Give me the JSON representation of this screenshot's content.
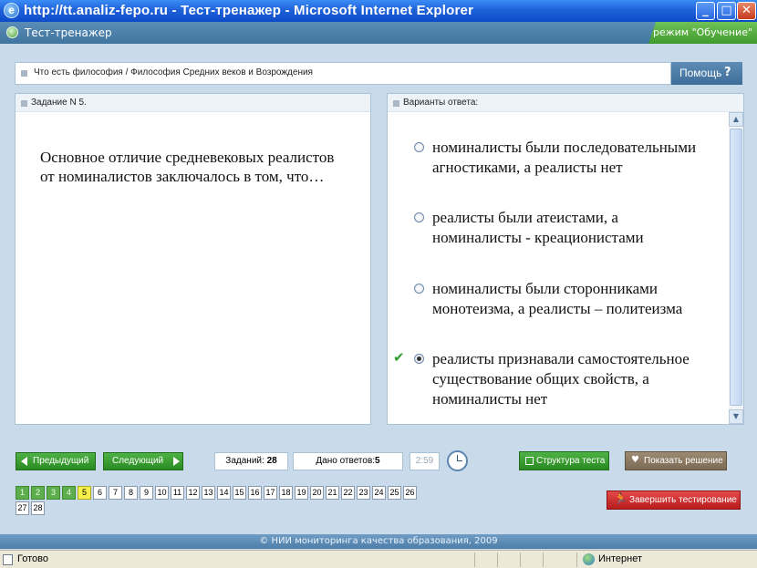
{
  "window": {
    "title": "http://tt.analiz-fepo.ru - Тест-тренажер - Microsoft Internet Explorer"
  },
  "app": {
    "title": "Тест-тренажер",
    "mode": "режим \"Обучение\""
  },
  "breadcrumb": {
    "path": "Что есть философия / Философия Средних веков и Возрождения"
  },
  "help": {
    "label": "Помощь",
    "icon": "?"
  },
  "task": {
    "header": "Задание N 5.",
    "question": "Основное  отличие средневековых реалистов от номиналистов заключалось в том, что…"
  },
  "answers": {
    "header": "Варианты ответа:",
    "options": [
      {
        "text": "номиналисты были последовательными агностиками, а реалисты нет",
        "selected": false,
        "correct": false
      },
      {
        "text": "реалисты были атеистами, а номиналисты - креационистами",
        "selected": false,
        "correct": false
      },
      {
        "text": "номиналисты были сторонниками монотеизма, а реалисты – политеизма",
        "selected": false,
        "correct": false
      },
      {
        "text": "реалисты признавали самостоятельное существование общих свойств, а номиналисты нет",
        "selected": true,
        "correct": true
      }
    ]
  },
  "nav": {
    "prev_label": "Предыдущий",
    "next_label": "Следующий",
    "tasks_label": "Заданий:",
    "tasks_count": "28",
    "answered_label": "Дано ответов:",
    "answered_count": "5",
    "timer": "2:59",
    "structure_label": "Структура теста",
    "solution_label": "Показать решение",
    "finish_label": "Завершить тестирование"
  },
  "questions": {
    "numbers": [
      "1",
      "2",
      "3",
      "4",
      "5",
      "6",
      "7",
      "8",
      "9",
      "10",
      "11",
      "12",
      "13",
      "14",
      "15",
      "16",
      "17",
      "18",
      "19",
      "20",
      "21",
      "22",
      "23",
      "24",
      "25",
      "26",
      "27",
      "28"
    ],
    "done": [
      "1",
      "2",
      "3",
      "4"
    ],
    "current": "5"
  },
  "footer": {
    "copyright": "© НИИ мониторинга качества образования, 2009"
  },
  "statusbar": {
    "ready": "Готово",
    "zone": "Интернет"
  },
  "colors": {
    "title_bar": "#1f62d8",
    "app_bar": "#4a80ab",
    "mode_badge": "#4fa83a",
    "nav_button": "#3a9c31",
    "finish_button": "#c92a2a",
    "current_question": "#f6f04a",
    "done_question": "#5fae4e"
  }
}
